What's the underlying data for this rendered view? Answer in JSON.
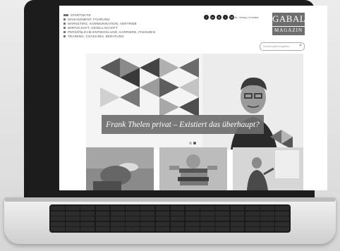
{
  "nav": {
    "items": [
      {
        "label": "STARTSEITE"
      },
      {
        "label": "MANAGEMENT, FÜHRUNG"
      },
      {
        "label": "MARKETING, KOMMUNIKATION, VERTRIEB"
      },
      {
        "label": "WIRTSCHAFT, GESELLSCHAFT"
      },
      {
        "label": "PERSÖNLICHE ENTWICKLUNG, KARRIERE, FINANZEN"
      },
      {
        "label": "TRAINING, COACHING, BERATUNG"
      }
    ]
  },
  "social": {
    "icons": [
      {
        "name": "facebook-icon",
        "glyph": "f"
      },
      {
        "name": "linkedin-icon",
        "glyph": "in"
      },
      {
        "name": "instagram-icon",
        "glyph": "◎"
      },
      {
        "name": "twitter-icon",
        "glyph": "t"
      },
      {
        "name": "email-icon",
        "glyph": "✉"
      }
    ]
  },
  "header": {
    "toplinks": "GABAL Verlag  |  Kontakt",
    "logo_top": "GABAL",
    "logo_bottom": "MAGAZIN"
  },
  "search": {
    "placeholder": "Suchbegriff eingeben",
    "icon": "magnifier-icon"
  },
  "hero": {
    "caption": "Frank Thelen privat – Existiert das überhaupt?",
    "slides_total": 2,
    "slide_active": 2
  },
  "colors": {
    "frame": "#1c1c1c",
    "logo_bg": "#6e6e6e",
    "caption_bg": "#6e6e6e"
  }
}
